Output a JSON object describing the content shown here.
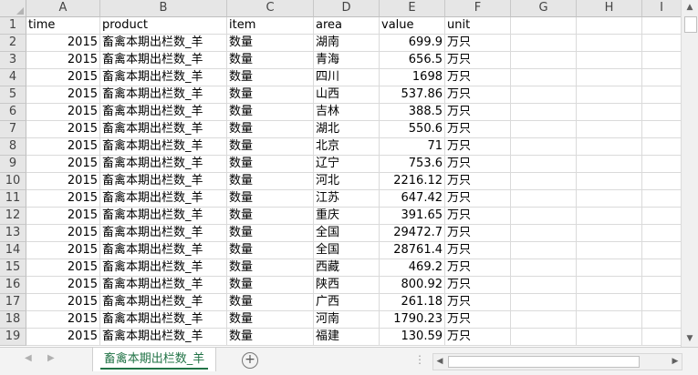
{
  "columns": [
    "A",
    "B",
    "C",
    "D",
    "E",
    "F",
    "G",
    "H",
    "I"
  ],
  "header_row": {
    "num": "1",
    "cells": [
      "time",
      "product",
      "item",
      "area",
      "value",
      "unit"
    ]
  },
  "rows": [
    {
      "num": "2",
      "time": "2015",
      "product": "畜禽本期出栏数_羊",
      "item": "数量",
      "area": "湖南",
      "value": "699.9",
      "unit": "万只"
    },
    {
      "num": "3",
      "time": "2015",
      "product": "畜禽本期出栏数_羊",
      "item": "数量",
      "area": "青海",
      "value": "656.5",
      "unit": "万只"
    },
    {
      "num": "4",
      "time": "2015",
      "product": "畜禽本期出栏数_羊",
      "item": "数量",
      "area": "四川",
      "value": "1698",
      "unit": "万只"
    },
    {
      "num": "5",
      "time": "2015",
      "product": "畜禽本期出栏数_羊",
      "item": "数量",
      "area": "山西",
      "value": "537.86",
      "unit": "万只"
    },
    {
      "num": "6",
      "time": "2015",
      "product": "畜禽本期出栏数_羊",
      "item": "数量",
      "area": "吉林",
      "value": "388.5",
      "unit": "万只"
    },
    {
      "num": "7",
      "time": "2015",
      "product": "畜禽本期出栏数_羊",
      "item": "数量",
      "area": "湖北",
      "value": "550.6",
      "unit": "万只"
    },
    {
      "num": "8",
      "time": "2015",
      "product": "畜禽本期出栏数_羊",
      "item": "数量",
      "area": "北京",
      "value": "71",
      "unit": "万只"
    },
    {
      "num": "9",
      "time": "2015",
      "product": "畜禽本期出栏数_羊",
      "item": "数量",
      "area": "辽宁",
      "value": "753.6",
      "unit": "万只"
    },
    {
      "num": "10",
      "time": "2015",
      "product": "畜禽本期出栏数_羊",
      "item": "数量",
      "area": "河北",
      "value": "2216.12",
      "unit": "万只"
    },
    {
      "num": "11",
      "time": "2015",
      "product": "畜禽本期出栏数_羊",
      "item": "数量",
      "area": "江苏",
      "value": "647.42",
      "unit": "万只"
    },
    {
      "num": "12",
      "time": "2015",
      "product": "畜禽本期出栏数_羊",
      "item": "数量",
      "area": "重庆",
      "value": "391.65",
      "unit": "万只"
    },
    {
      "num": "13",
      "time": "2015",
      "product": "畜禽本期出栏数_羊",
      "item": "数量",
      "area": "全国",
      "value": "29472.7",
      "unit": "万只"
    },
    {
      "num": "14",
      "time": "2015",
      "product": "畜禽本期出栏数_羊",
      "item": "数量",
      "area": "全国",
      "value": "28761.4",
      "unit": "万只"
    },
    {
      "num": "15",
      "time": "2015",
      "product": "畜禽本期出栏数_羊",
      "item": "数量",
      "area": "西藏",
      "value": "469.2",
      "unit": "万只"
    },
    {
      "num": "16",
      "time": "2015",
      "product": "畜禽本期出栏数_羊",
      "item": "数量",
      "area": "陕西",
      "value": "800.92",
      "unit": "万只"
    },
    {
      "num": "17",
      "time": "2015",
      "product": "畜禽本期出栏数_羊",
      "item": "数量",
      "area": "广西",
      "value": "261.18",
      "unit": "万只"
    },
    {
      "num": "18",
      "time": "2015",
      "product": "畜禽本期出栏数_羊",
      "item": "数量",
      "area": "河南",
      "value": "1790.23",
      "unit": "万只"
    },
    {
      "num": "19",
      "time": "2015",
      "product": "畜禽本期出栏数_羊",
      "item": "数量",
      "area": "福建",
      "value": "130.59",
      "unit": "万只"
    }
  ],
  "sheet_tab": {
    "label": "畜禽本期出栏数_羊"
  },
  "add_sheet_symbol": "+",
  "accent_color": "#217346"
}
